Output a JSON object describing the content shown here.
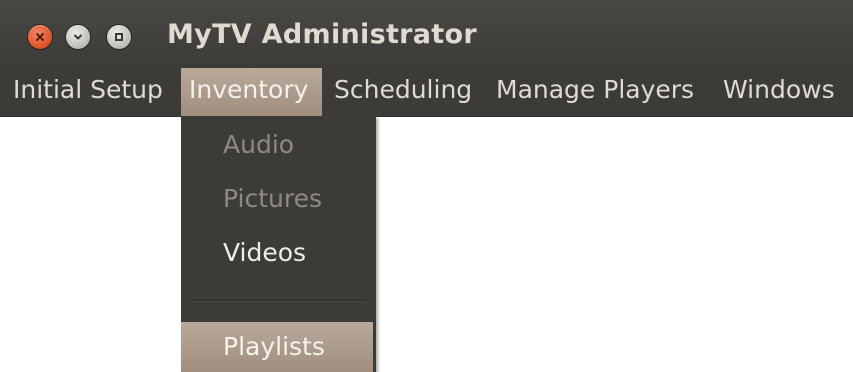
{
  "window": {
    "title": "MyTV Administrator"
  },
  "menubar": {
    "items": [
      {
        "label": "Initial Setup"
      },
      {
        "label": "Inventory"
      },
      {
        "label": "Scheduling"
      },
      {
        "label": "Manage Players"
      },
      {
        "label": "Windows"
      }
    ],
    "active": "Inventory"
  },
  "dropdown": {
    "items": [
      {
        "label": "Audio",
        "state": "disabled"
      },
      {
        "label": "Pictures",
        "state": "disabled"
      },
      {
        "label": "Videos",
        "state": "enabled"
      },
      {
        "label": "Playlists",
        "state": "highlighted"
      }
    ]
  },
  "colors": {
    "titlebar": "#3c3b37",
    "text": "#dfdbd2",
    "highlight": "#a08f7f",
    "close_button": "#d94f26"
  }
}
